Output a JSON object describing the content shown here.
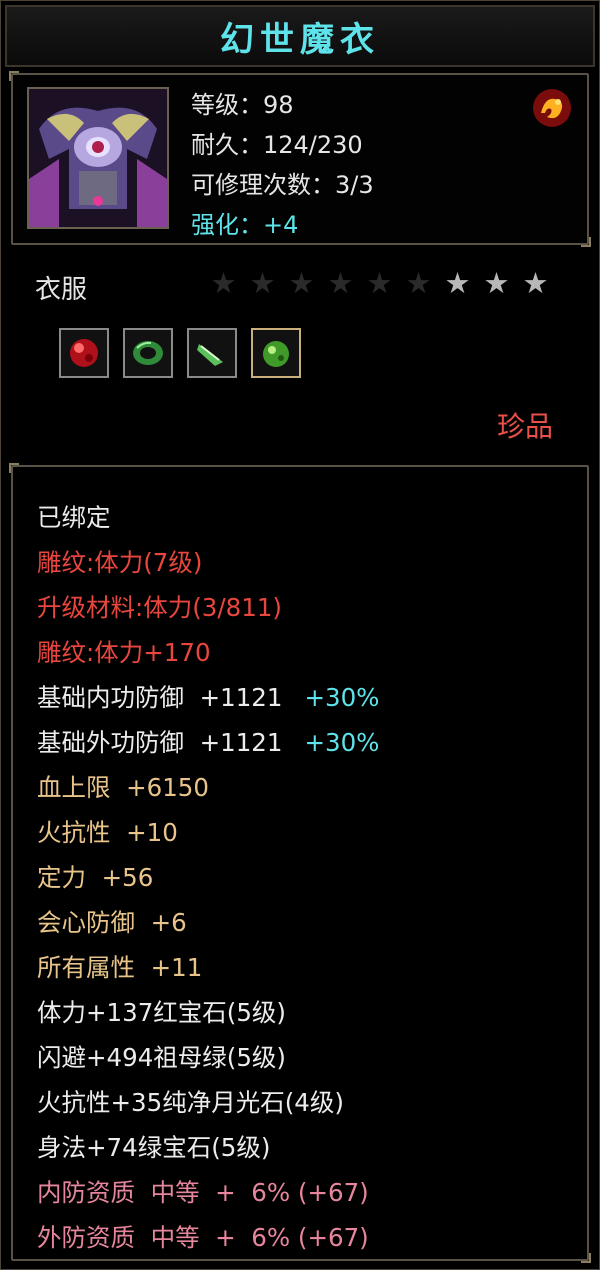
{
  "item": {
    "name": "幻世魔衣",
    "stats": {
      "level": "等级：98",
      "durability": "耐久：124/230",
      "repairs": "可修理次数：3/3",
      "enhance": "强化：+4"
    },
    "type": "衣服",
    "stars": {
      "total": 9,
      "lit": 3
    },
    "rarity": "珍品",
    "gems": [
      "red-gem-icon",
      "green-bracelet-icon",
      "green-crystal-icon",
      "green-pearl-icon"
    ]
  },
  "attributes": [
    {
      "text": "已绑定",
      "color": "white"
    },
    {
      "text": "雕纹:体力(7级)",
      "color": "red"
    },
    {
      "text": "升级材料:体力(3/811)",
      "color": "red"
    },
    {
      "text": "雕纹:体力+170",
      "color": "red"
    },
    {
      "text": "基础内功防御  +1121",
      "suffix": "+30%",
      "color": "white"
    },
    {
      "text": "基础外功防御  +1121",
      "suffix": "+30%",
      "color": "white"
    },
    {
      "text": "血上限  +6150",
      "color": "tan"
    },
    {
      "text": "火抗性  +10",
      "color": "tan"
    },
    {
      "text": "定力  +56",
      "color": "tan"
    },
    {
      "text": "会心防御  +6",
      "color": "tan"
    },
    {
      "text": "所有属性  +11",
      "color": "tan"
    },
    {
      "text": "体力+137红宝石(5级)",
      "color": "white"
    },
    {
      "text": "闪避+494祖母绿(5级)",
      "color": "white"
    },
    {
      "text": "火抗性+35纯净月光石(4级)",
      "color": "white"
    },
    {
      "text": "身法+74绿宝石(5级)",
      "color": "white"
    },
    {
      "text": "内防资质  中等  +  6% (+67)",
      "color": "pink"
    },
    {
      "text": "外防资质  中等  +  6% (+67)",
      "color": "pink"
    }
  ]
}
